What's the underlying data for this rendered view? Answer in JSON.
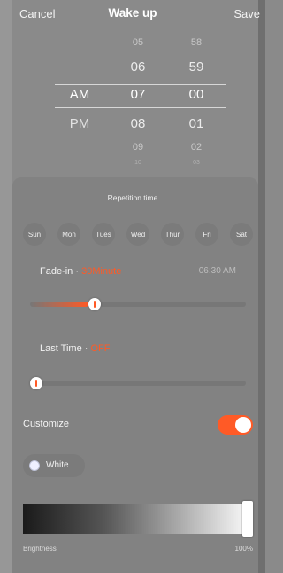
{
  "header": {
    "cancel_label": "Cancel",
    "title": "Wake up",
    "save_label": "Save"
  },
  "picker": {
    "period": {
      "above": "",
      "selected": "AM",
      "below": "PM"
    },
    "hours": [
      "05",
      "06",
      "07",
      "08",
      "09",
      "10"
    ],
    "minutes": [
      "58",
      "59",
      "00",
      "01",
      "02",
      "03"
    ],
    "selected_hour": "07",
    "selected_minute": "00"
  },
  "repetition": {
    "title": "Repetition time",
    "days": [
      "Sun",
      "Mon",
      "Tues",
      "Wed",
      "Thur",
      "Fri",
      "Sat"
    ]
  },
  "fade_in": {
    "label": "Fade-in · ",
    "value": "30Minute",
    "time": "06:30 AM",
    "level": 0.27
  },
  "last_time": {
    "label": "Last Time · ",
    "value": "OFF",
    "level": 0.0
  },
  "customize": {
    "label": "Customize",
    "enabled": true
  },
  "color_chip": {
    "label": "White"
  },
  "brightness": {
    "label": "Brightness",
    "value_label": "100%",
    "level": 1.0
  },
  "colors": {
    "accent": "#ff5a26",
    "background": "#8a8a8a"
  }
}
